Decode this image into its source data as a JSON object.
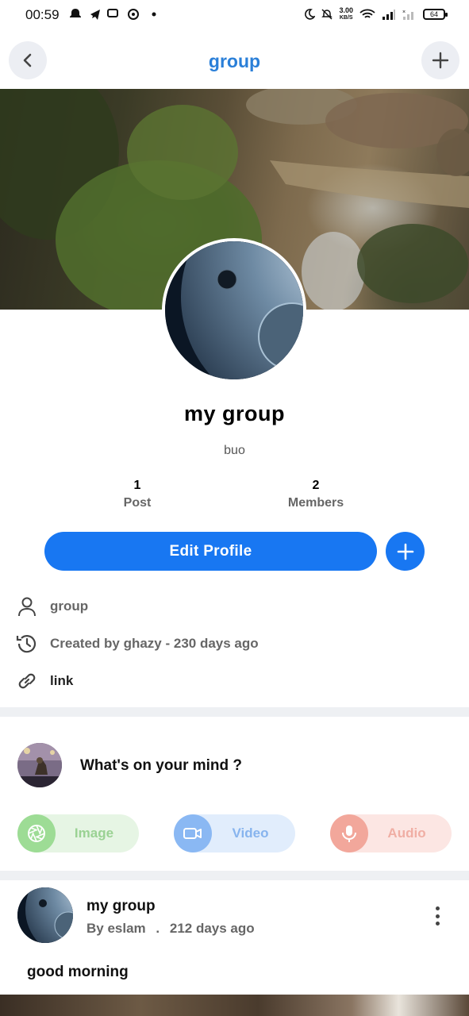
{
  "status_bar": {
    "time": "00:59",
    "net_speed_value": "3.00",
    "net_speed_unit": "KB/S",
    "battery": "64"
  },
  "header": {
    "title": "group"
  },
  "group": {
    "name": "my group",
    "description": "buo"
  },
  "stats": {
    "posts_count": "1",
    "posts_label": "Post",
    "members_count": "2",
    "members_label": "Members"
  },
  "actions": {
    "edit_profile_label": "Edit Profile"
  },
  "info": {
    "type": "group",
    "created": "Created by ghazy - 230 days ago",
    "link": "link"
  },
  "composer": {
    "prompt": "What's on your mind ?",
    "image_label": "Image",
    "video_label": "Video",
    "audio_label": "Audio"
  },
  "post": {
    "title": "my group",
    "author": "By eslam",
    "separator": ".",
    "time": "212 days ago",
    "body": "good morning"
  },
  "colors": {
    "accent": "#1877f2",
    "title": "#2a7fd8",
    "image": "#9ddc95",
    "video": "#8ab8f3",
    "audio": "#f2a79b"
  }
}
